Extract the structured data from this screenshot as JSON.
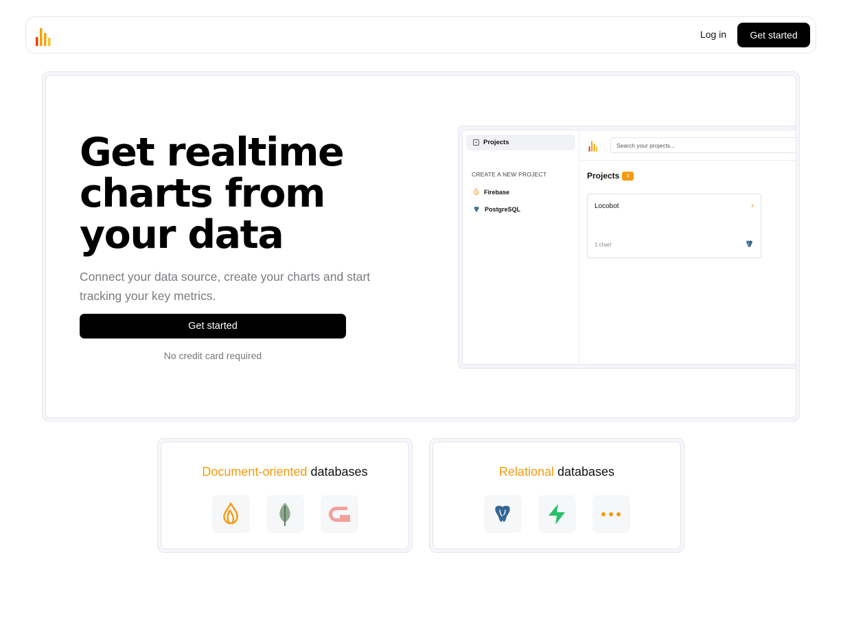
{
  "nav": {
    "logo_icon": "bar-chart-logo-icon",
    "login_label": "Log in",
    "cta_label": "Get started"
  },
  "hero": {
    "title_line1": "Get realtime",
    "title_line2": "charts from",
    "title_line3": "your data",
    "subtitle": "Connect your data source, create your charts and start tracking your key metrics.",
    "cta_label": "Get started",
    "note": "No credit card required"
  },
  "preview": {
    "sidebar": {
      "active_item": "Projects",
      "section_label": "CREATE A NEW PROJECT",
      "sources": [
        {
          "label": "Firebase",
          "icon": "firebase-icon"
        },
        {
          "label": "PostgreSQL",
          "icon": "postgresql-icon"
        }
      ]
    },
    "search_placeholder": "Search your projects...",
    "projects_title": "Projects",
    "projects_count": "1",
    "card": {
      "name": "Locobot",
      "chart_count": "1 chart",
      "db_icon": "postgresql-icon"
    }
  },
  "databases": {
    "document": {
      "accent": "Document-oriented",
      "rest": " databases",
      "icons": [
        "firebase-icon",
        "mongodb-icon",
        "couchbase-icon"
      ]
    },
    "relational": {
      "accent": "Relational",
      "rest": " databases",
      "icons": [
        "postgresql-icon",
        "supabase-icon",
        "more-icon"
      ]
    }
  },
  "colors": {
    "accent": "#f59a0c",
    "primary": "#000000",
    "muted_text": "#7a7a80"
  }
}
